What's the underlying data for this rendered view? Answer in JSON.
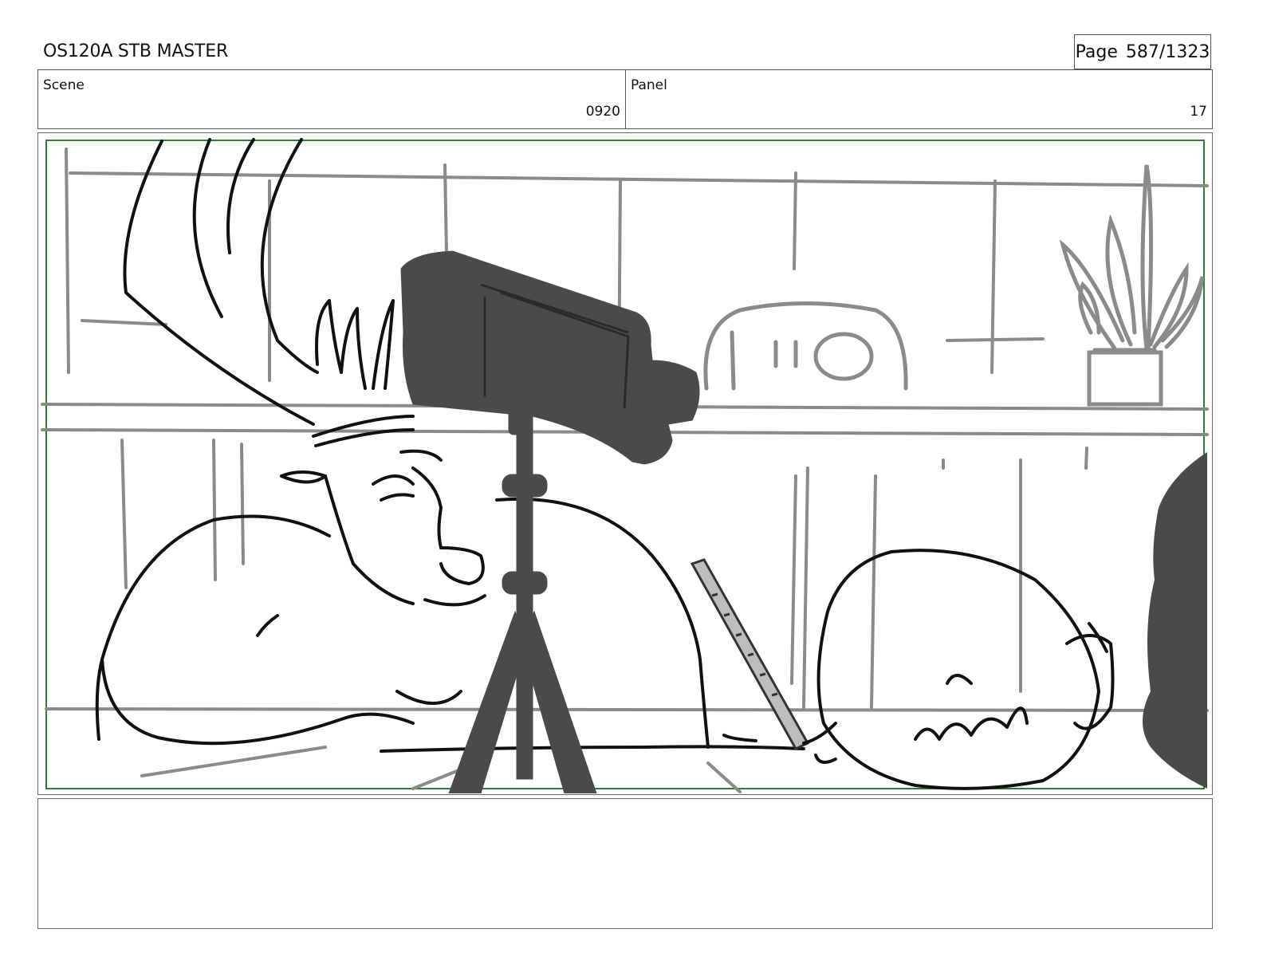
{
  "header": {
    "title": "OS120A STB MASTER",
    "page_label": "Page",
    "page_value": "587/1323"
  },
  "meta": {
    "scene_label": "Scene",
    "scene_value": "0920",
    "panel_label": "Panel",
    "panel_value": "17"
  },
  "colors": {
    "safe_area_border": "#2e7d32",
    "camera_fill": "#4a4a4a",
    "sketch_line": "#111111",
    "background_line": "#8a8a8a"
  }
}
